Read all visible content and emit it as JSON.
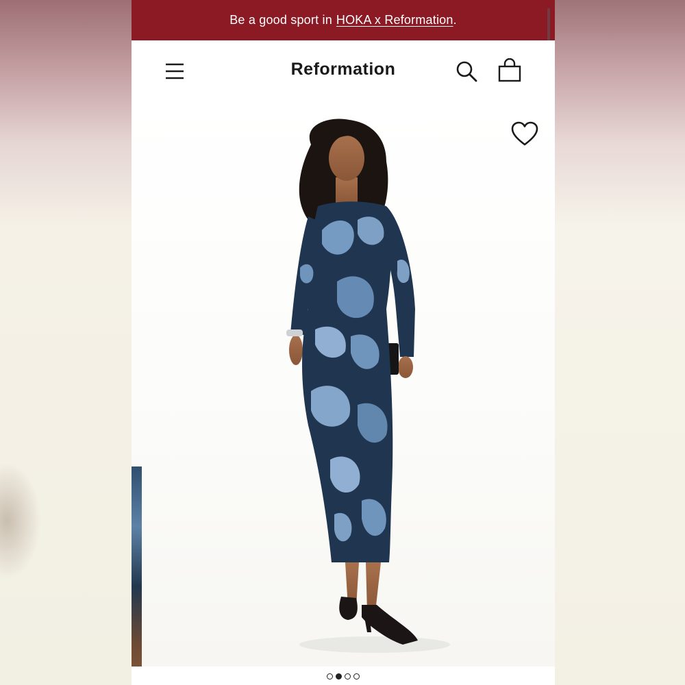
{
  "promo": {
    "text": "Be a good sport in",
    "link_text": "HOKA x Reformation",
    "suffix": "."
  },
  "header": {
    "logo": "Reformation",
    "menu_icon": "hamburger-menu-icon",
    "search_icon": "search-icon",
    "bag_icon": "shopping-bag-icon"
  },
  "gallery": {
    "wishlist_icon": "heart-icon",
    "image_description": "Model in long-sleeve blue floral-print maxi dress",
    "slide_count": 4,
    "active_slide": 2
  },
  "colors": {
    "promo_bg": "#8b1a25",
    "dress_dark": "#1f3550",
    "dress_light": "#7fa6cf"
  }
}
